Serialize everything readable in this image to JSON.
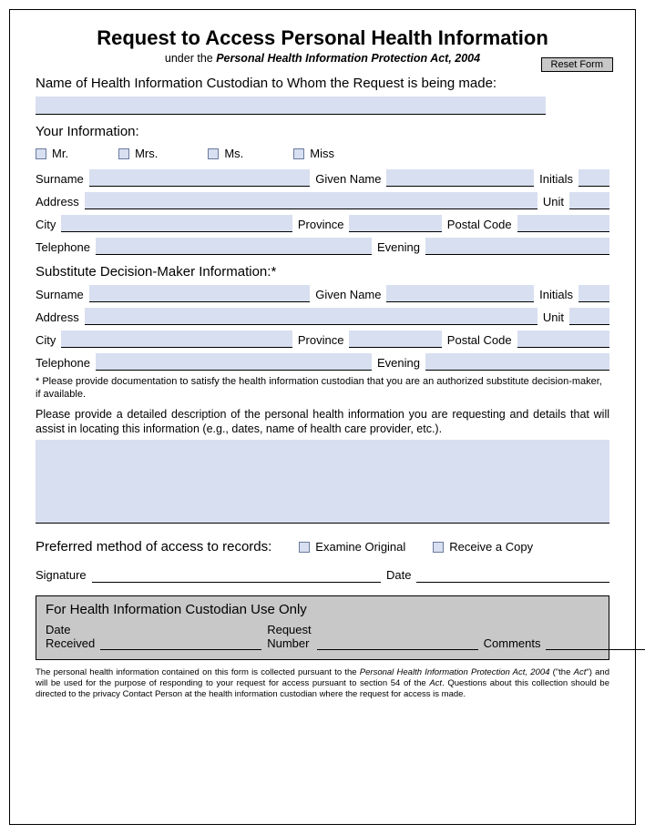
{
  "header": {
    "title": "Request to Access Personal Health Information",
    "subtitle_prefix": "under the ",
    "subtitle_act": "Personal Health Information Protection Act, 2004",
    "reset_button": "Reset Form"
  },
  "custodian_label": "Name of Health Information Custodian to Whom the Request is being made:",
  "your_info": {
    "heading": "Your Information:",
    "titles": {
      "mr": "Mr.",
      "mrs": "Mrs.",
      "ms": "Ms.",
      "miss": "Miss"
    },
    "labels": {
      "surname": "Surname",
      "given_name": "Given Name",
      "initials": "Initials",
      "address": "Address",
      "unit": "Unit",
      "city": "City",
      "province": "Province",
      "postal_code": "Postal Code",
      "telephone": "Telephone",
      "evening": "Evening"
    }
  },
  "sdm": {
    "heading": "Substitute Decision-Maker Information:*",
    "labels": {
      "surname": "Surname",
      "given_name": "Given Name",
      "initials": "Initials",
      "address": "Address",
      "unit": "Unit",
      "city": "City",
      "province": "Province",
      "postal_code": "Postal Code",
      "telephone": "Telephone",
      "evening": "Evening"
    },
    "note": "* Please provide documentation to satisfy the health information custodian that you are an authorized substitute decision-maker, if available."
  },
  "description": {
    "prompt": "Please provide a detailed description of the personal health information you are requesting and details that will assist in locating this information (e.g., dates, name of health care provider, etc.)."
  },
  "preferred": {
    "heading": "Preferred method of access to records:",
    "examine": "Examine Original",
    "receive": "Receive a Copy"
  },
  "signature": {
    "signature_label": "Signature",
    "date_label": "Date"
  },
  "custodian_use": {
    "heading": "For Health Information Custodian Use Only",
    "date_received": "Date Received",
    "request_number": "Request Number",
    "comments": "Comments"
  },
  "footer": {
    "text_a": "The personal health information contained on this form is collected pursuant to the ",
    "act1": "Personal Health Information Protection Act, 2004",
    "text_b": " (\"the ",
    "act2": "Act",
    "text_c": "\") and will be used for the purpose of responding to your request for access pursuant to section 54 of the ",
    "act3": "Act",
    "text_d": ". Questions about this collection should be directed to the privacy Contact Person at the health information custodian where the request for access is made."
  }
}
